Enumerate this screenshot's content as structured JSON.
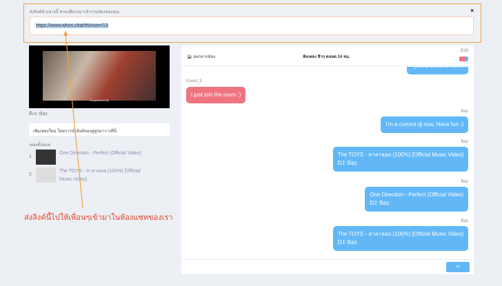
{
  "modal": {
    "hint": "ส่งลิงค์ข้างล่างนี้ ชวนเพื่อนๆมาเข้าร่วมห้องของคุณ",
    "url": "https://www.whos.chat/th/room/13",
    "close": "×"
  },
  "player": {
    "subtitle": "I'm gonna let it fly",
    "dj_label": "ดีเจ: Baz"
  },
  "add_song": "เพิ่มเพลงใหม่ โดยการนำลิงค์ของยูทูปมาวางที่นี่",
  "playlist": {
    "title": "เพลงทั้งหมด",
    "items": [
      {
        "n": "1",
        "title": "One Direction - Perfect (Official Video)"
      },
      {
        "n": "2",
        "title": "The TOYS - ลาลาลอย (100%) [Official Music Video]"
      }
    ]
  },
  "annotation": "ส่งลิงค์นี้ไปให้เพื่อนๆเข้ามาในห้องแชทของเรา",
  "chat": {
    "leave": "ออกจากห้อง",
    "title": "ฟังเพลง ชิวๆ ตลอด 24 ชม.",
    "count": "2/10",
    "occupancy": 0.2,
    "messages": [
      {
        "user": "",
        "text": "I just created a room.",
        "mine": true
      },
      {
        "user": "Guest_3",
        "text": "I just join the room :)",
        "mine": false
      },
      {
        "user": "Baz",
        "text": "I'm a current dj now, Have fun :)",
        "mine": true
      },
      {
        "user": "Baz",
        "text": "The TOYS - ลาลาลอย (100%) [Official Music Video]",
        "dj": "DJ: Baz",
        "mine": true
      },
      {
        "user": "Baz",
        "text": "One Direction - Perfect (Official Video)",
        "dj": "DJ: Baz",
        "mine": true
      },
      {
        "user": "Baz",
        "text": "The TOYS - ลาลาลอย (100%) [Official Music Video]",
        "dj": "DJ: Baz",
        "mine": true
      }
    ],
    "send": "ส่ง"
  }
}
